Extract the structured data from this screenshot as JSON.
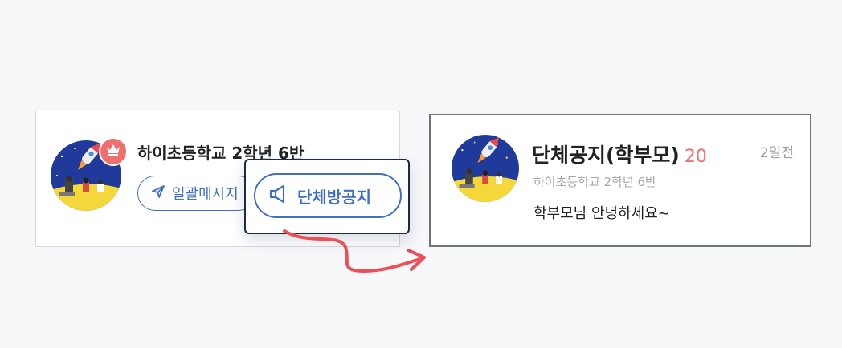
{
  "colors": {
    "accent_blue": "#3f6fc6",
    "badge_red": "#ef6e6e",
    "popup_border": "#1c2a44"
  },
  "left_card": {
    "group_name": "하이초등학교 2학년 6반",
    "bulk_message_label": "일괄메시지",
    "bulk_message_icon": "send-icon",
    "badge_icon": "crown-icon"
  },
  "popup": {
    "group_notice_label": "단체방공지",
    "icon": "megaphone-icon"
  },
  "notice_card": {
    "title": "단체공지(학부모)",
    "count": "20",
    "time": "2일전",
    "group_name": "하이초등학교 2학년 6반",
    "message": "학부모님 안녕하세요~"
  }
}
